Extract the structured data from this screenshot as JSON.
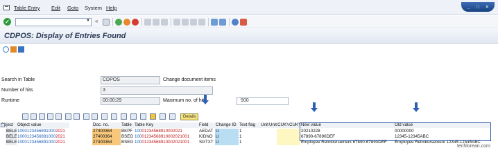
{
  "menu": {
    "items": [
      "Table Entry",
      "Edit",
      "Goto",
      "System",
      "Help"
    ]
  },
  "toolbar": {
    "command_field": ""
  },
  "title": "CDPOS: Display of Entries Found",
  "form": {
    "search_in_table_label": "Search in Table",
    "search_in_table_value": "CDPOS",
    "change_doc_items_label": "Change document items",
    "number_of_hits_label": "Number of hits",
    "number_of_hits_value": "3",
    "runtime_label": "Runtime",
    "runtime_value": "00:00:29",
    "max_hits_label": "Maximum no. of hits",
    "max_hits_value": "500"
  },
  "alv": {
    "details_label": "Details"
  },
  "table": {
    "headers": [
      "Object",
      "Object value",
      "Doc. no.",
      "Table",
      "Table Key",
      "Field",
      "Change ID",
      "Text flag",
      "Unit",
      "Unit",
      "CUKY",
      "CUKY",
      "New value",
      "Old value"
    ],
    "rows": [
      {
        "object": "BELEG",
        "objval_a": "1000123456891000",
        "objval_b": "2021",
        "docno": "27400364",
        "table": "BKPF",
        "tabkey_a": "100",
        "tabkey_b": "01234568910002021",
        "field": "AEDAT",
        "chngid": "U",
        "textflag": "1",
        "new": "20210228",
        "old": "00000000"
      },
      {
        "object": "BELEG",
        "objval_a": "1000123456891000",
        "objval_b": "2021",
        "docno": "27400364",
        "table": "BSEG",
        "tabkey_a": "100",
        "tabkey_b": "01234568910002021001",
        "field": "KIDNO",
        "chngid": "U",
        "textflag": "1",
        "new": "67890-67890DEF",
        "old": "12345-12345ABC"
      },
      {
        "object": "BELEG",
        "objval_a": "1000123456891000",
        "objval_b": "2021",
        "docno": "27400364",
        "table": "BSEG",
        "tabkey_a": "100",
        "tabkey_b": "01234568910002021001",
        "field": "SGTXT",
        "chngid": "U",
        "textflag": "1",
        "new": "Employee Reimbursement 67890-67890DEF",
        "old": "Employee Reimbursement 12345-12345ABC"
      }
    ]
  },
  "watermark": "techlorean.com",
  "colors": {
    "accent": "#2f5fb3",
    "doc_highlight": "#f7c77b",
    "change_id_highlight": "#b9def3"
  }
}
